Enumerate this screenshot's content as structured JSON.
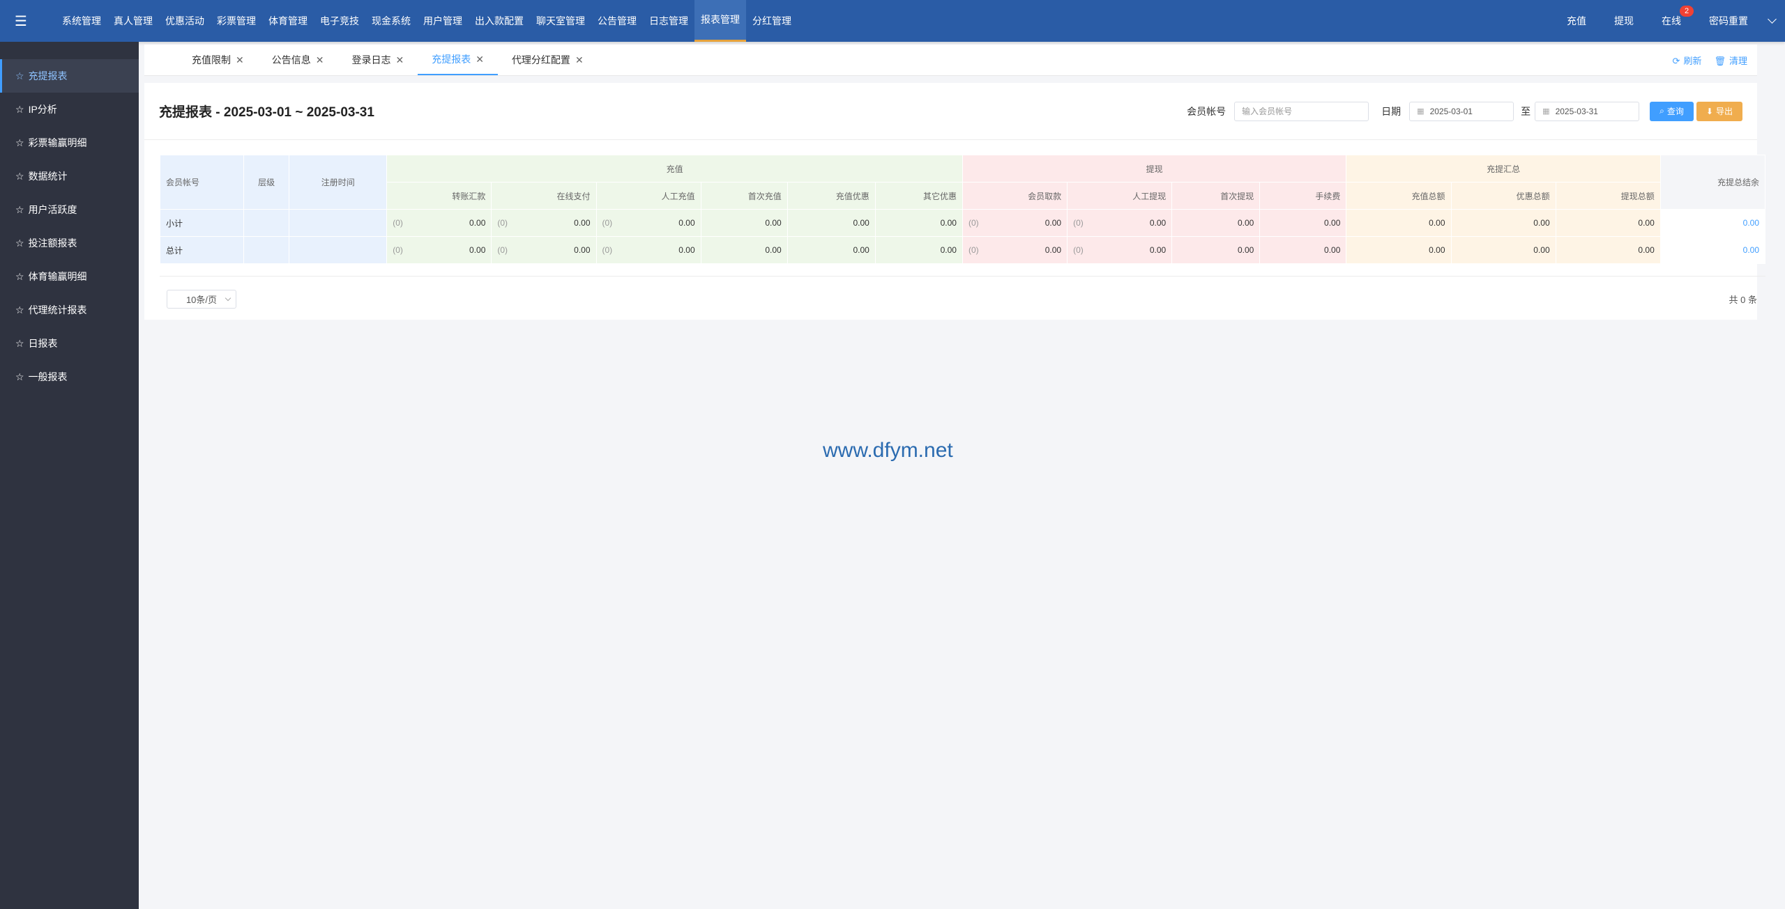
{
  "topnav": {
    "items": [
      "系统管理",
      "真人管理",
      "优惠活动",
      "彩票管理",
      "体育管理",
      "电子竞技",
      "现金系统",
      "用户管理",
      "出入款配置",
      "聊天室管理",
      "公告管理",
      "日志管理",
      "报表管理",
      "分红管理"
    ],
    "active_index": 12,
    "right": {
      "recharge": "充值",
      "withdraw": "提现",
      "online": "在线",
      "online_badge": "2",
      "password": "密码重置"
    }
  },
  "sidebar": {
    "items": [
      "充提报表",
      "IP分析",
      "彩票输赢明细",
      "数据统计",
      "用户活跃度",
      "投注额报表",
      "体育输赢明细",
      "代理统计报表",
      "日报表",
      "一般报表"
    ],
    "active_index": 0
  },
  "tabs": {
    "items": [
      "充值限制",
      "公告信息",
      "登录日志",
      "充提报表",
      "代理分红配置"
    ],
    "active_index": 3,
    "refresh": "刷新",
    "clear": "清理"
  },
  "report": {
    "title": "充提报表 - 2025-03-01 ~ 2025-03-31",
    "member_label": "会员帐号",
    "member_placeholder": "输入会员帐号",
    "date_label": "日期",
    "date_from": "2025-03-01",
    "date_to_sep": "至",
    "date_to": "2025-03-31",
    "query": "查询",
    "export": "导出"
  },
  "table": {
    "groups": {
      "recharge": "充值",
      "withdraw": "提现",
      "summary": "充提汇总",
      "total": "充提总结余"
    },
    "columns": {
      "member": "会员帐号",
      "level": "层级",
      "reg_time": "注册时间",
      "transfer": "转账汇款",
      "online_pay": "在线支付",
      "manual_recharge": "人工充值",
      "first_recharge": "首次充值",
      "recharge_bonus": "充值优惠",
      "other_bonus": "其它优惠",
      "member_withdraw": "会员取款",
      "manual_withdraw": "人工提现",
      "first_withdraw": "首次提现",
      "fee": "手续费",
      "recharge_total": "充值总额",
      "bonus_total": "优惠总额",
      "withdraw_total": "提现总额"
    },
    "rows": [
      {
        "label": "小计",
        "count": "(0)",
        "zero": "0.00"
      },
      {
        "label": "总计",
        "count": "(0)",
        "zero": "0.00"
      }
    ]
  },
  "footer": {
    "page_size": "10条/页",
    "total": "共 0 条"
  },
  "watermark": "www.dfym.net"
}
